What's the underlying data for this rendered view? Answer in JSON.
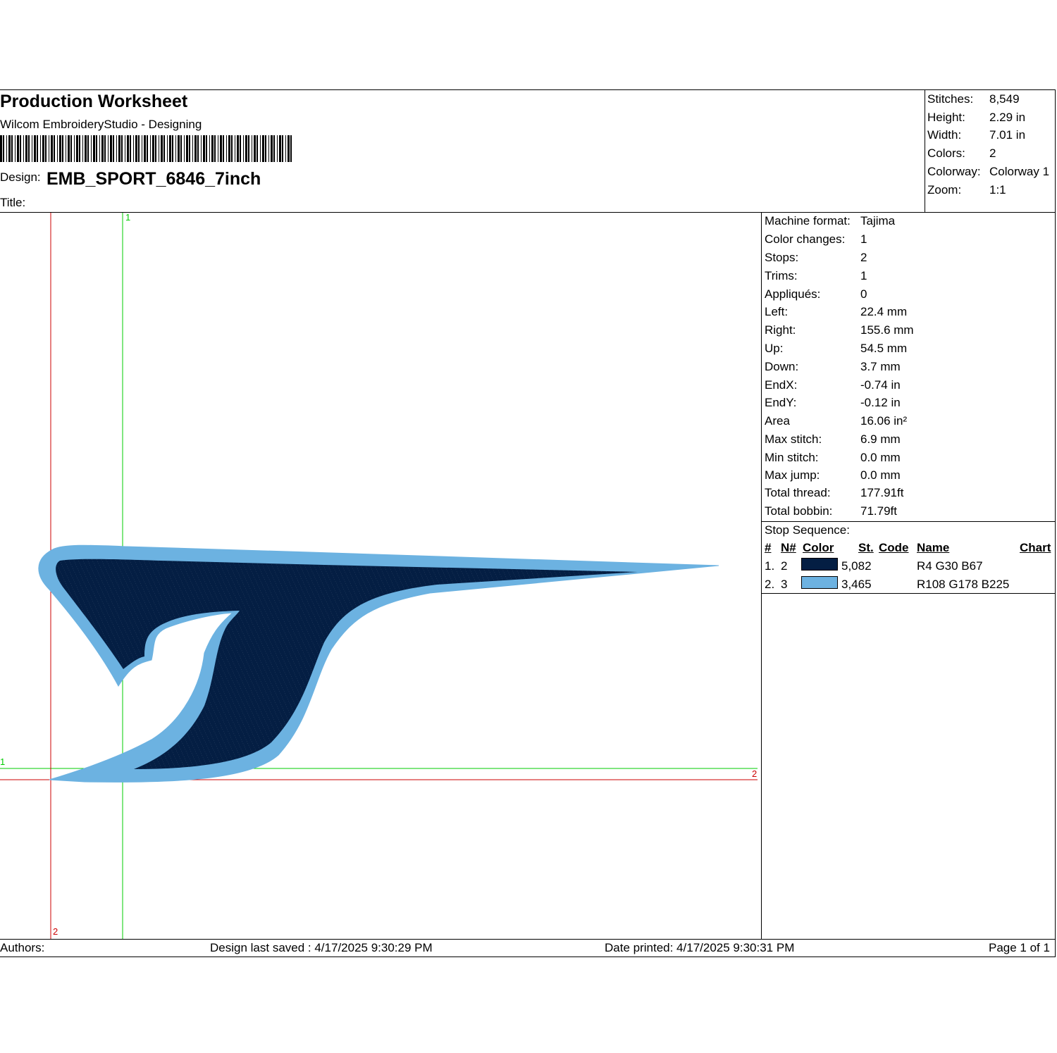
{
  "header": {
    "title": "Production Worksheet",
    "software": "Wilcom EmbroideryStudio - Designing",
    "design_label": "Design:",
    "design_name": "EMB_SPORT_6846_7inch",
    "title_label": "Title:"
  },
  "summary": {
    "rows": [
      {
        "label": "Stitches:",
        "value": "8,549"
      },
      {
        "label": "Height:",
        "value": "2.29 in"
      },
      {
        "label": "Width:",
        "value": "7.01 in"
      },
      {
        "label": "Colors:",
        "value": "2"
      },
      {
        "label": "Colorway:",
        "value": "Colorway 1"
      },
      {
        "label": "Zoom:",
        "value": "1:1"
      }
    ]
  },
  "machine": {
    "rows": [
      {
        "label": "Machine format:",
        "value": "Tajima"
      },
      {
        "label": "Color changes:",
        "value": "1"
      },
      {
        "label": "Stops:",
        "value": "2"
      },
      {
        "label": "Trims:",
        "value": "1"
      },
      {
        "label": "Appliqués:",
        "value": "0"
      },
      {
        "label": "Left:",
        "value": "22.4 mm"
      },
      {
        "label": "Right:",
        "value": "155.6 mm"
      },
      {
        "label": "Up:",
        "value": "54.5 mm"
      },
      {
        "label": "Down:",
        "value": "3.7 mm"
      },
      {
        "label": "EndX:",
        "value": "-0.74 in"
      },
      {
        "label": "EndY:",
        "value": "-0.12 in"
      },
      {
        "label": "Area",
        "value": " 16.06 in²"
      },
      {
        "label": "Max stitch:",
        "value": "6.9 mm"
      },
      {
        "label": "Min stitch:",
        "value": "0.0 mm"
      },
      {
        "label": "Max jump:",
        "value": "0.0 mm"
      },
      {
        "label": "Total thread:",
        "value": "177.91ft"
      },
      {
        "label": "Total bobbin:",
        "value": "71.79ft"
      }
    ]
  },
  "stop_sequence": {
    "label": "Stop Sequence:",
    "headers": {
      "num": "#",
      "needle": "N#",
      "color": "Color",
      "stitches": "St.",
      "code": "Code",
      "name": "Name",
      "chart": "Chart"
    },
    "rows": [
      {
        "num": "1.",
        "needle": "2",
        "swatch": "#041e43",
        "stitches": "5,082",
        "code": "",
        "name": "R4 G30 B67",
        "chart": ""
      },
      {
        "num": "2.",
        "needle": "3",
        "swatch": "#6cb2e1",
        "stitches": "3,465",
        "code": "",
        "name": "R108 G178 B225",
        "chart": ""
      }
    ]
  },
  "canvas": {
    "marker_green_1": "1",
    "marker_red_2": "2",
    "colors": {
      "dark_thread": "#041e43",
      "light_thread": "#6cb2e1",
      "guide_green": "#00cc00",
      "guide_red": "#cc0000"
    }
  },
  "footer": {
    "authors": "Authors:",
    "last_saved": "Design last saved : 4/17/2025 9:30:29 PM",
    "printed": "Date printed: 4/17/2025 9:30:31 PM",
    "page": "Page 1 of 1"
  }
}
